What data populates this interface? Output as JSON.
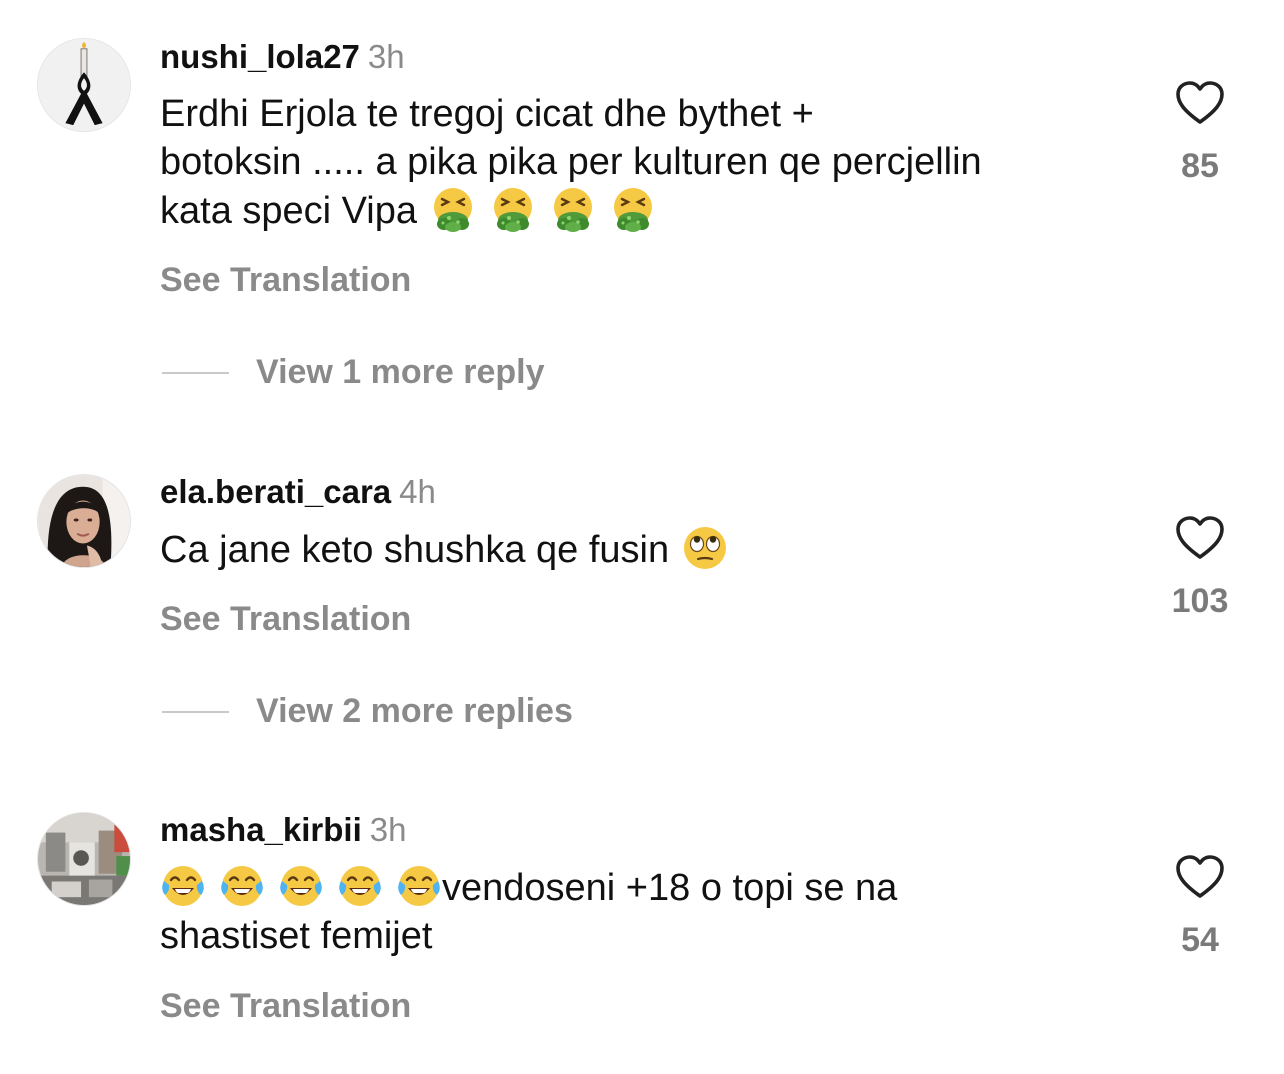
{
  "comments": [
    {
      "username": "nushi_lola27",
      "time": "3h",
      "text_line1": "Erdhi Erjola te tregoj cicat dhe bythet +",
      "text_line2": "botoksin ..... a pika pika per kulturen qe percjellin",
      "text_line3": "kata speci Vipa",
      "emojis": [
        "vomiting-face",
        "vomiting-face",
        "vomiting-face",
        "vomiting-face"
      ],
      "see_translation": "See Translation",
      "replies_label": "View 1 more reply",
      "likes": "85",
      "avatar_icon": "black-ribbon-candle"
    },
    {
      "username": "ela.berati_cara",
      "time": "4h",
      "text_line1": "Ca jane keto shushka qe fusin",
      "emojis": [
        "face-with-rolling-eyes"
      ],
      "see_translation": "See Translation",
      "replies_label": "View 2 more replies",
      "likes": "103",
      "avatar_icon": "profile-photo"
    },
    {
      "username": "masha_kirbii",
      "time": "3h",
      "text_line1": "vendoseni +18 o topi se na",
      "text_line2": "shastiset femijet",
      "emojis": [
        "face-with-tears-of-joy",
        "face-with-tears-of-joy",
        "face-with-tears-of-joy",
        "face-with-tears-of-joy",
        "face-with-tears-of-joy"
      ],
      "see_translation": "See Translation",
      "likes": "54",
      "avatar_icon": "profile-photo"
    }
  ],
  "colors": {
    "primary_text": "#111111",
    "secondary_text": "#8a8a8a",
    "divider": "#c9c9c9",
    "background": "#ffffff"
  }
}
